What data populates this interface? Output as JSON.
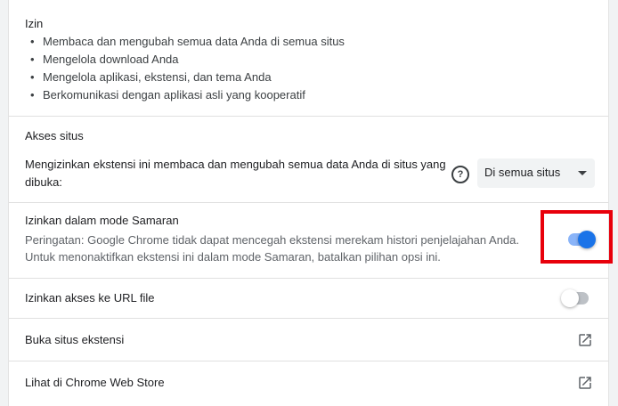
{
  "permissions": {
    "heading": "Izin",
    "items": [
      "Membaca dan mengubah semua data Anda di semua situs",
      "Mengelola download Anda",
      "Mengelola aplikasi, ekstensi, dan tema Anda",
      "Berkomunikasi dengan aplikasi asli yang kooperatif"
    ]
  },
  "site_access": {
    "heading": "Akses situs",
    "description_line1": "Mengizinkan ekstensi ini membaca dan mengubah semua data Anda di situs yang",
    "description_line2": "dibuka:",
    "help_icon": "help-circle-icon",
    "select_value": "Di semua situs"
  },
  "incognito": {
    "title": "Izinkan dalam mode Samaran",
    "warning_line1": "Peringatan: Google Chrome tidak dapat mencegah ekstensi merekam histori penjelajahan Anda.",
    "warning_line2": "Untuk menonaktifkan ekstensi ini dalam mode Samaran, batalkan pilihan opsi ini.",
    "enabled": true
  },
  "file_urls": {
    "title": "Izinkan akses ke URL file",
    "enabled": false
  },
  "links": {
    "site_label": "Buka situs ekstensi",
    "webstore_label": "Lihat di Chrome Web Store",
    "icon": "open-in-new-icon"
  },
  "colors": {
    "accent": "#1a73e8",
    "highlight_box": "#e8000b"
  }
}
